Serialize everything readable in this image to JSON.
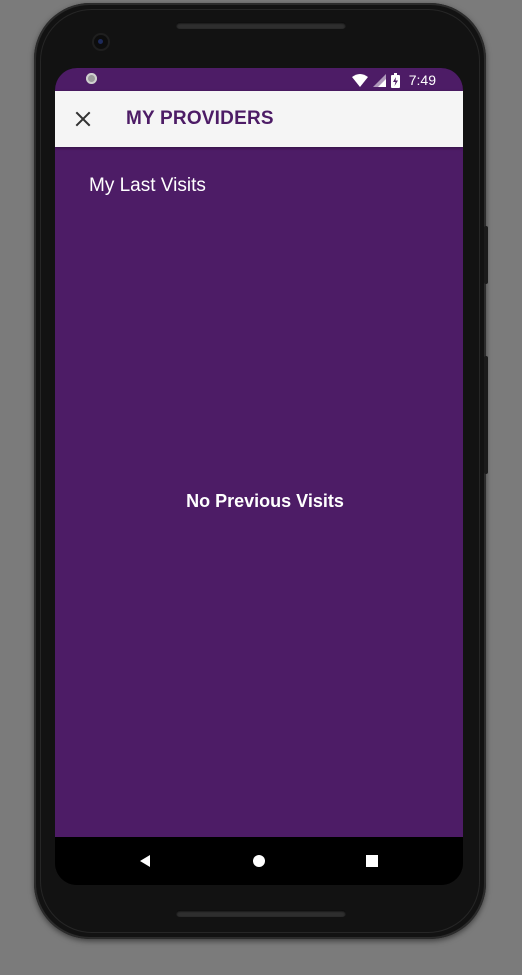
{
  "status_bar": {
    "time": "7:49",
    "icons": [
      "notification-dot-icon",
      "wifi-icon",
      "signal-icon",
      "battery-charging-icon"
    ]
  },
  "app_bar": {
    "close_icon": "close-icon",
    "title": "MY PROVIDERS"
  },
  "content": {
    "section_title": "My Last Visits",
    "empty_message": "No Previous Visits"
  },
  "nav_bar": {
    "icons": [
      "back-triangle-icon",
      "home-circle-icon",
      "recents-square-icon"
    ]
  },
  "colors": {
    "primary": "#4d1c66",
    "app_bar_bg": "#f5f5f5",
    "text_on_primary": "#ffffff",
    "device_bezel": "#121212",
    "backdrop": "#7b7b7b"
  }
}
